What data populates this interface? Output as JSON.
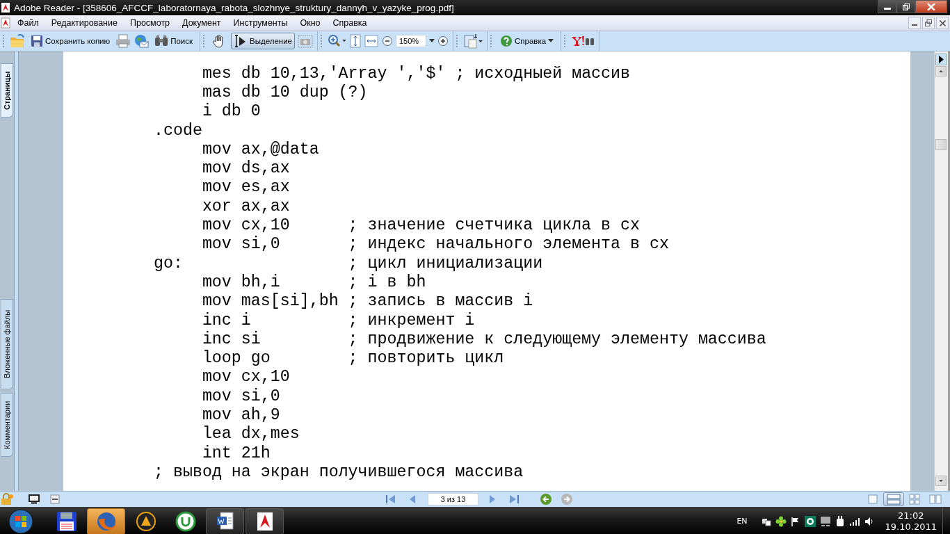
{
  "window": {
    "title": "Adobe Reader - [358606_AFCCF_laboratornaya_rabota_slozhnye_struktury_dannyh_v_yazyke_prog.pdf]"
  },
  "menu": [
    "Файл",
    "Редактирование",
    "Просмотр",
    "Документ",
    "Инструменты",
    "Окно",
    "Справка"
  ],
  "toolbar": {
    "save_copy": "Сохранить копию",
    "search": "Поиск",
    "hand_tool": {
      "selected": false
    },
    "select_tool": {
      "label": "Выделение",
      "selected": true
    },
    "zoom": {
      "value": "150%"
    },
    "help": "Справка"
  },
  "nav_tabs": [
    {
      "label": "Страницы",
      "selected": true
    },
    {
      "label": "Вложенные файлы",
      "selected": false
    },
    {
      "label": "Комментарии",
      "selected": false
    }
  ],
  "document": {
    "lines": [
      {
        "indented": true,
        "code": "mes db 10,13,'Array ','$' ; исходныей массив"
      },
      {
        "indented": true,
        "code": "mas db 10 dup (?)"
      },
      {
        "indented": true,
        "code": "i db 0"
      },
      {
        "indented": false,
        "code": ".code"
      },
      {
        "indented": true,
        "code": "mov ax,@data"
      },
      {
        "indented": true,
        "code": "mov ds,ax"
      },
      {
        "indented": true,
        "code": "mov es,ax"
      },
      {
        "indented": true,
        "code": "xor ax,ax"
      },
      {
        "indented": true,
        "code": "mov cx,10",
        "comment": "; значение счетчика цикла в cx"
      },
      {
        "indented": true,
        "code": "mov si,0",
        "comment": "; индекс начального элемента в cx"
      },
      {
        "indented": false,
        "code": "go:",
        "comment": "; цикл инициализации"
      },
      {
        "indented": true,
        "code": "mov bh,i",
        "comment": "; i в bh"
      },
      {
        "indented": true,
        "code": "mov mas[si],bh",
        "comment": "; запись в массив i"
      },
      {
        "indented": true,
        "code": "inc i",
        "comment": "; инкремент i"
      },
      {
        "indented": true,
        "code": "inc si",
        "comment": "; продвижение к следующему элементу массива"
      },
      {
        "indented": true,
        "code": "loop go",
        "comment": "; повторить цикл"
      },
      {
        "indented": true,
        "code": "mov cx,10"
      },
      {
        "indented": true,
        "code": "mov si,0"
      },
      {
        "indented": true,
        "code": "mov ah,9"
      },
      {
        "indented": true,
        "code": "lea dx,mes"
      },
      {
        "indented": true,
        "code": "int 21h"
      },
      {
        "indented": false,
        "code": "; вывод на экран получившегося массива"
      }
    ]
  },
  "status_bar": {
    "page_field": "3 из 13",
    "view_modes": [
      {
        "selected": false
      },
      {
        "selected": true
      },
      {
        "selected": false
      },
      {
        "selected": false
      }
    ]
  },
  "taskbar": {
    "apps": [
      {
        "highlighted": false,
        "active": false
      },
      {
        "highlighted": true,
        "active": false
      },
      {
        "highlighted": false,
        "active": false
      },
      {
        "highlighted": false,
        "active": false
      },
      {
        "highlighted": false,
        "active": true
      },
      {
        "highlighted": false,
        "active": true
      }
    ],
    "language": "EN",
    "time": "21:02",
    "date": "19.10.2011"
  }
}
